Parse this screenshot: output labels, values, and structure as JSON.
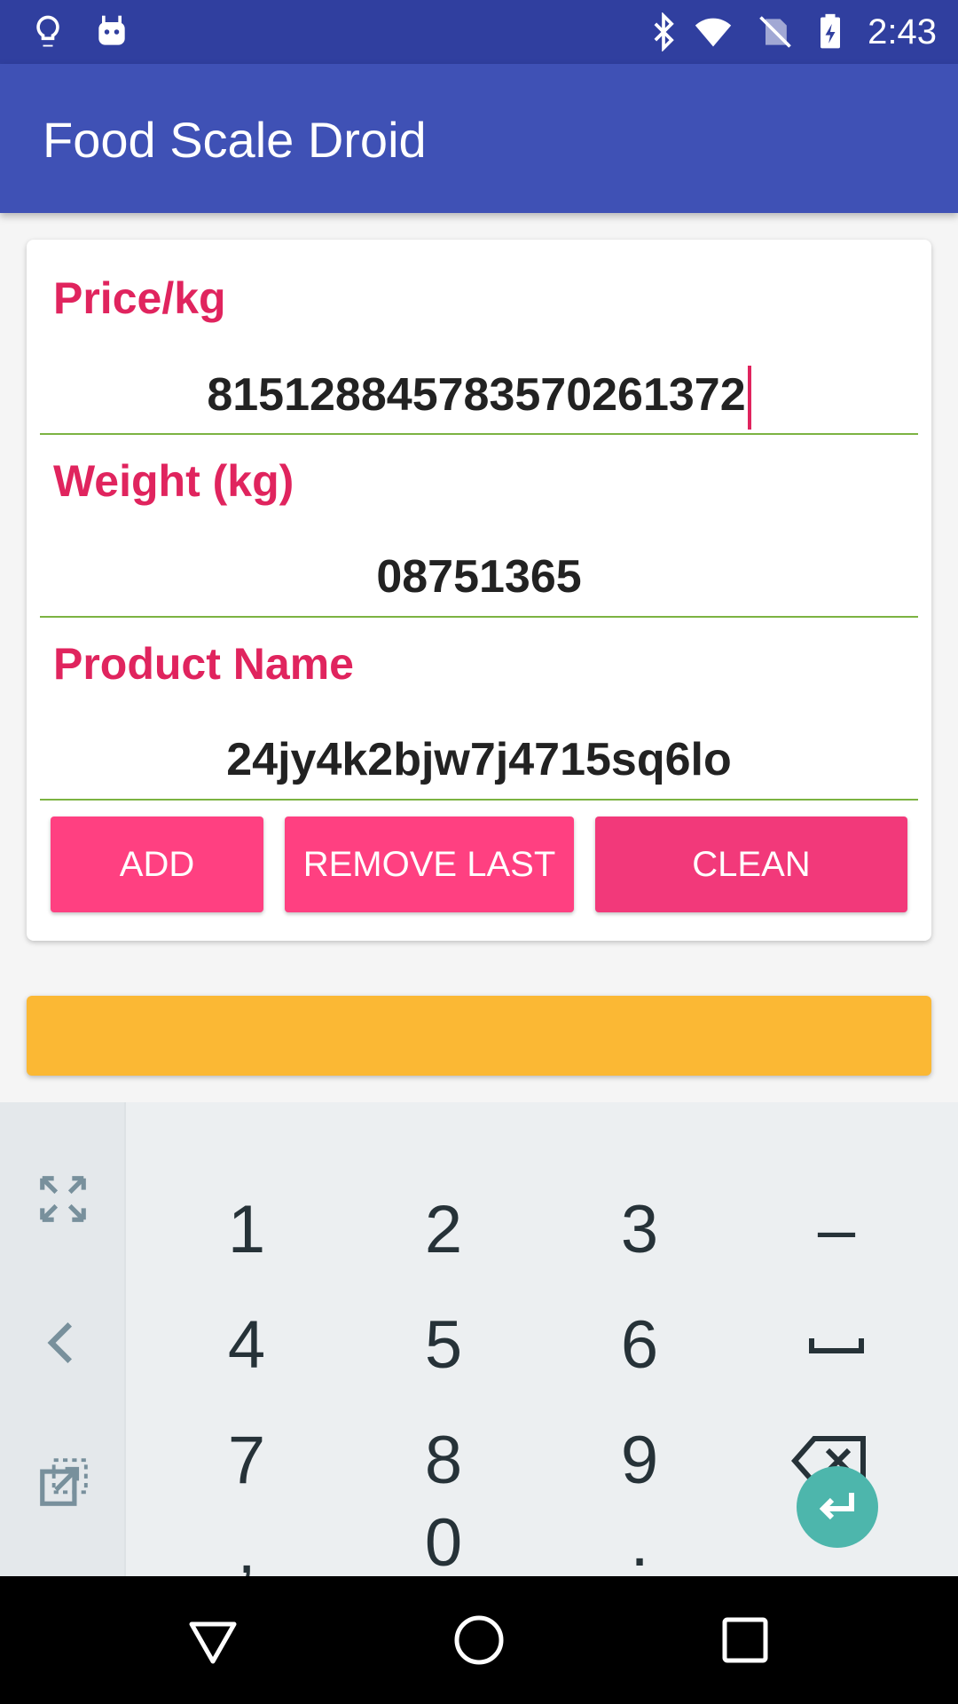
{
  "status_bar": {
    "time": "2:43",
    "icons": [
      "lightbulb-icon",
      "android-icon",
      "bluetooth-icon",
      "wifi-icon",
      "no-sim-icon",
      "battery-charging-icon"
    ]
  },
  "app_bar": {
    "title": "Food Scale Droid"
  },
  "form": {
    "price": {
      "label": "Price/kg",
      "value": "815128845783570261372"
    },
    "weight": {
      "label": "Weight (kg)",
      "value": "08751365"
    },
    "product": {
      "label": "Product Name",
      "value": "24jy4k2bjw7j4715sq6lo"
    }
  },
  "buttons": {
    "add": "ADD",
    "remove_last": "REMOVE LAST",
    "clean": "CLEAN"
  },
  "colors": {
    "status_bar": "#303f9f",
    "app_bar": "#3f51b5",
    "label": "#e0245e",
    "button": "#ff4081",
    "underline": "#7cb342",
    "result_bar": "#fbb834",
    "enter_key": "#4db6ac"
  },
  "keyboard": {
    "side_icons": [
      "fullscreen-icon",
      "back-arrow-icon",
      "popout-icon"
    ],
    "rows": [
      [
        "1",
        "2",
        "3",
        "–"
      ],
      [
        "4",
        "5",
        "6",
        "space-icon"
      ],
      [
        "7",
        "8",
        "9",
        "backspace-icon"
      ],
      [
        ",",
        "0",
        ".",
        "enter-icon"
      ]
    ]
  },
  "nav_bar": {
    "icons": [
      "back-icon",
      "home-icon",
      "recents-icon"
    ]
  }
}
